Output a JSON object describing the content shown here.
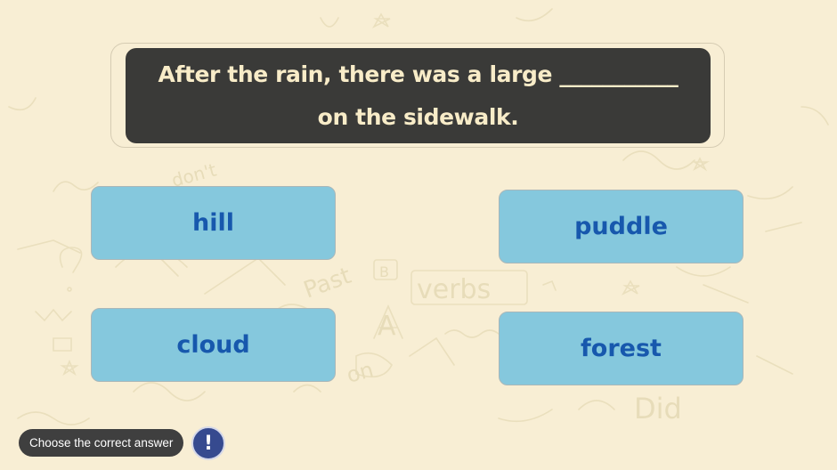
{
  "question": {
    "text": "After the rain, there was a large ___________ on the sidewalk."
  },
  "answers": [
    {
      "label": "hill"
    },
    {
      "label": "puddle"
    },
    {
      "label": "cloud"
    },
    {
      "label": "forest"
    }
  ],
  "footer": {
    "instruction": "Choose the correct answer",
    "hint_symbol": "!"
  },
  "background_doodles": {
    "words": [
      "don't",
      "Past",
      "verbs",
      "Did",
      "on",
      "B",
      "A"
    ]
  },
  "colors": {
    "background": "#f8eed4",
    "question_box": "#3a3a38",
    "question_text": "#f8ecc8",
    "answer_fill": "#85c8dd",
    "answer_text": "#1758ad",
    "hint_button": "#364a8f"
  }
}
